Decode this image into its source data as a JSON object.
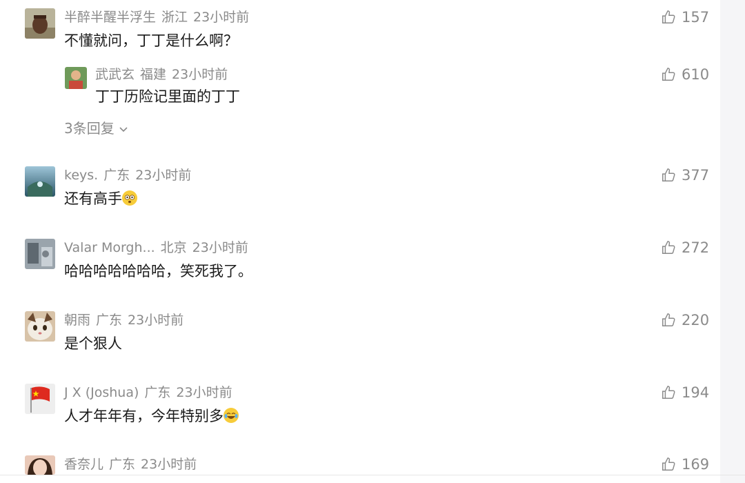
{
  "comments": [
    {
      "name": "半醉半醒半浮生",
      "location": "浙江",
      "time": "23小时前",
      "text": "不懂就问，丁丁是什么啊？",
      "likes": "157"
    },
    {
      "name": "keys.",
      "location": "广东",
      "time": "23小时前",
      "text": "还有高手",
      "likes": "377"
    },
    {
      "name": "Valar Morgh...",
      "location": "北京",
      "time": "23小时前",
      "text": "哈哈哈哈哈哈哈，笑死我了。",
      "likes": "272"
    },
    {
      "name": "朝雨",
      "location": "广东",
      "time": "23小时前",
      "text": "是个狠人",
      "likes": "220"
    },
    {
      "name": "J  X  (Joshua)",
      "location": "广东",
      "time": "23小时前",
      "text": "人才年年有，今年特别多",
      "likes": "194"
    },
    {
      "name": "香奈儿",
      "location": "广东",
      "time": "23小时前",
      "text": "",
      "likes": "169"
    }
  ],
  "reply": {
    "name": "武武玄",
    "location": "福建",
    "time": "23小时前",
    "text": "丁丁历险记里面的丁丁",
    "likes": "610"
  },
  "more_replies": "3条回复",
  "colors": {
    "meta": "#8a8a8a",
    "text": "#1a1a1a",
    "emoji": "#f7cc3a"
  }
}
